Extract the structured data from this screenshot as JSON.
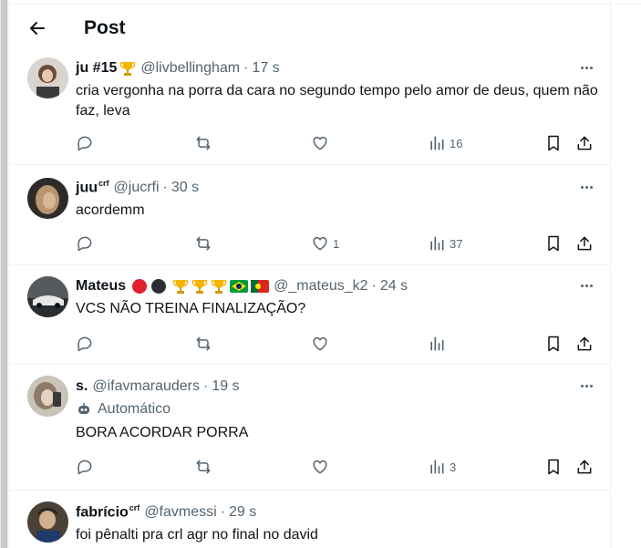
{
  "header": {
    "title": "Post"
  },
  "posts": [
    {
      "name": "ju #15",
      "name_sup": "",
      "handle": "@livbellingham",
      "time": "17 s",
      "automated": "",
      "text": "cria vergonha na porra da cara no segundo tempo pelo amor de deus, quem não faz, leva",
      "likes": "",
      "views": "16"
    },
    {
      "name": "juu",
      "name_sup": "crf",
      "handle": "@jucrfi",
      "time": "30 s",
      "automated": "",
      "text": "acordemm",
      "likes": "1",
      "views": "37"
    },
    {
      "name": "Mateus",
      "name_sup": "",
      "handle": "@_mateus_k2",
      "time": "24 s",
      "automated": "",
      "text": "VCS NÃO TREINA FINALIZAÇÃO?",
      "likes": "",
      "views": ""
    },
    {
      "name": "s.",
      "name_sup": "",
      "handle": "@ifavmarauders",
      "time": "19 s",
      "automated": "Automático",
      "text": "BORA ACORDAR PORRA",
      "likes": "",
      "views": "3"
    },
    {
      "name": "fabrício",
      "name_sup": "crf",
      "handle": "@favmessi",
      "time": "29 s",
      "automated": "",
      "text": "foi pênalti pra crl agr no final no david",
      "likes": "",
      "views": ""
    }
  ],
  "sep": "·",
  "colors": {
    "text": "#0f1419",
    "muted": "#536471",
    "border": "#eff3f4",
    "trophy": "#f4b400",
    "red": "#e0202e"
  },
  "icons": [
    "back-arrow-icon",
    "more-icon",
    "reply-icon",
    "retweet-icon",
    "like-icon",
    "views-icon",
    "bookmark-icon",
    "share-icon",
    "robot-icon",
    "trophy-icon",
    "brazil-flag-icon",
    "portugal-flag-icon"
  ]
}
